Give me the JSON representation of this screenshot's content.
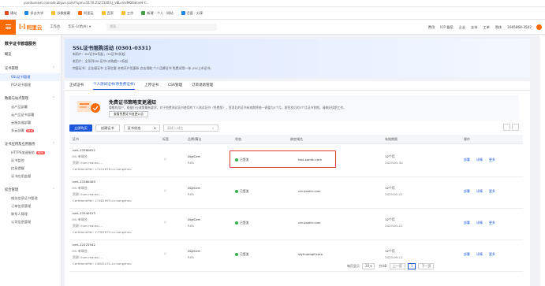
{
  "browser": {
    "url": "yundunnext.console.aliyun.com/?spm=5176.21213303.J_v8LsmxMG6alneH-Y...",
    "bookmarks": [
      "建站",
      "多吉大学",
      "谷歌收藏",
      "阿里云",
      "百家",
      "工作",
      "新建 - 个人 · 网站",
      "百度 · 分享"
    ]
  },
  "header": {
    "logo_text": "阿里云",
    "workbench": "工作台",
    "region": "华东-1(杭州)",
    "search_placeholder": "搜索...",
    "right_items": [
      "费用",
      "ICP 备案",
      "企业",
      "支持",
      "工单",
      "简体"
    ],
    "account": "1665868-3502"
  },
  "sidebar": {
    "title": "数字证书管理服务",
    "overview": "概览",
    "groups": [
      {
        "label": "证书管理",
        "items": [
          "SSL证书管理",
          "PCA证书管理"
        ]
      },
      {
        "label": "数据与站点管理",
        "items": [
          "云产品部署",
          "云产品证书部署",
          "云服务器部署",
          "多云部署"
        ]
      },
      {
        "label": "证书应用及应用服务",
        "items": [
          "HTTPS加速服务",
          "证书监控",
          "信息提醒",
          "证书应用监督"
        ]
      },
      {
        "label": "综合管理",
        "items": [
          "域名信息证书管理",
          "订单信息管理",
          "联系人管理",
          "公司信息管理"
        ]
      }
    ],
    "badge_new": "NEW"
  },
  "banner": {
    "title": "SSL证书限购活动 (0301-0331)",
    "lines": [
      "新用户：DV证书0折起，OV证书5折起",
      "老用户：全系列SSL证书1次购超7.5折起",
      "特惠证书：企业级证书 立享优惠 本地开户优惠券 点击领取 个人品牌证书 免费试用一年 (OV上市证书)"
    ]
  },
  "tabs": [
    "正式证书",
    "个人测试证书(原免费证书)",
    "上传证书",
    "CSR管理",
    "订单退款管理"
  ],
  "notice": {
    "title": "免费证书策略变更通知",
    "text": "尊敬的用户，根据行业政策最新要求，对于免费测试证书使用的个人测试证书（免费版），签发后的证书有效期将统一调整为3个月，即签发后的3个月证书到期，请做好续期工作。",
    "button": "查看免费证书变更公告"
  },
  "toolbar": {
    "create": "立即购买",
    "upload": "创建证书",
    "status_select": "证书状态",
    "search_placeholder": "请输入域名"
  },
  "table": {
    "headers": [
      "证书",
      "标签",
      "品牌/算法",
      "状态",
      "绑定域名",
      "有效期限",
      "操作"
    ],
    "rows": [
      {
        "id": "cert-13260812",
        "type": "DV 单域名",
        "account": "资源: liuer-reauto-...",
        "group": "CertIdentifier: 17414878-cn-hangzhou",
        "brand": "DigiCert",
        "algo": "RSA",
        "status": "已签发",
        "domain": "test.sanhh.com",
        "validity": "12个月",
        "expire": "2025-05-30",
        "actions": [
          "部署",
          "详情",
          "更多"
        ]
      },
      {
        "id": "cert-13360409",
        "type": "DV 单域名",
        "account": "资源: liuer-reauto-...",
        "group": "CertIdentifier: 17462993-cn-hangzhou",
        "brand": "DigiCert",
        "algo": "RSA",
        "status": "已签发",
        "domain": "cm.sanhh.com",
        "validity": "12个月",
        "expire": "2025-02-21",
        "actions": [
          "部署",
          "详情",
          "更多"
        ]
      },
      {
        "id": "cert-13340123",
        "type": "DV 单域名",
        "account": "资源: liuer-reauto-...",
        "group": "CertIdentifier: 17302875-cn-hangzhou",
        "brand": "DigiCert",
        "algo": "RSA",
        "status": "已签发",
        "domain": "cm.sanhh.com",
        "validity": "12个月",
        "expire": "2025-05-22",
        "actions": [
          "部署",
          "详情",
          "更多"
        ]
      },
      {
        "id": "cert-12275542",
        "type": "DV 单域名",
        "account": "资源: liuer-reauto-...",
        "group": "CertIdentifier: 14845231-cn-hangzhou",
        "brand": "DigiCert",
        "algo": "RSA",
        "status": "已签发",
        "domain": "styhuamglf.com",
        "validity": "12个月",
        "expire": "2025-09-11",
        "actions": [
          "部署",
          "详情",
          "更多"
        ]
      }
    ]
  },
  "pagination": {
    "label": "每页显示",
    "page_size": "20",
    "total": "共4条",
    "prev": "上一页",
    "current": "1",
    "next": "下一页"
  },
  "colors": {
    "brand": "#ff6a00",
    "primary": "#1a56db",
    "success": "#2cb14a",
    "highlight": "#e53935"
  }
}
